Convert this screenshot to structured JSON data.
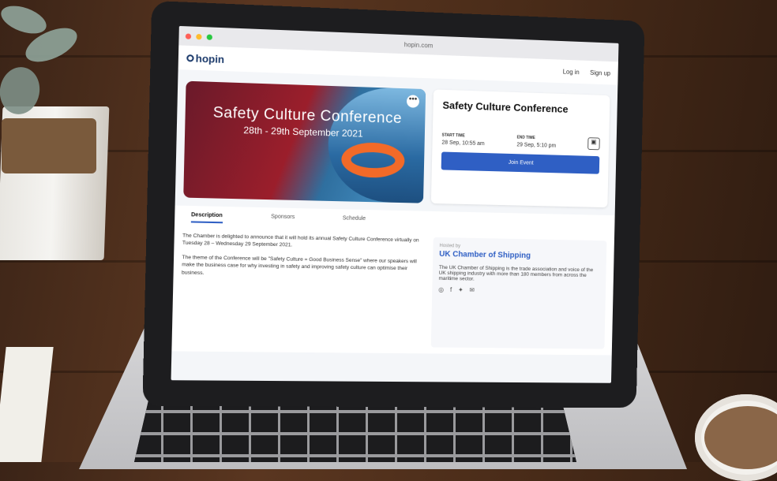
{
  "browser": {
    "url": "hopin.com"
  },
  "nav": {
    "logo": "hopin",
    "login": "Log in",
    "signup": "Sign up"
  },
  "banner": {
    "title": "Safety Culture Conference",
    "dates": "28th - 29th September 2021",
    "more": "•••"
  },
  "card": {
    "title": "Safety Culture Conference",
    "start_label": "START TIME",
    "start_value": "28 Sep, 10:55 am",
    "end_label": "END TIME",
    "end_value": "29 Sep, 5:10 pm",
    "join": "Join Event"
  },
  "tabs": [
    "Description",
    "Sponsors",
    "Schedule"
  ],
  "description": {
    "p1": "The Chamber is delighted to announce that it will hold its annual Safety Culture Conference virtually on Tuesday 28 – Wednesday 29 September 2021.",
    "p2": "The theme of the Conference will be \"Safety Culture = Good Business Sense\" where our speakers will make the business case for why investing in safety and improving safety culture can optimise their business."
  },
  "host": {
    "hosted_by": "Hosted by",
    "name": "UK Chamber of Shipping",
    "about": "The UK Chamber of Shipping is the trade association and voice of the UK shipping industry with more than 180 members from across the maritime sector."
  }
}
